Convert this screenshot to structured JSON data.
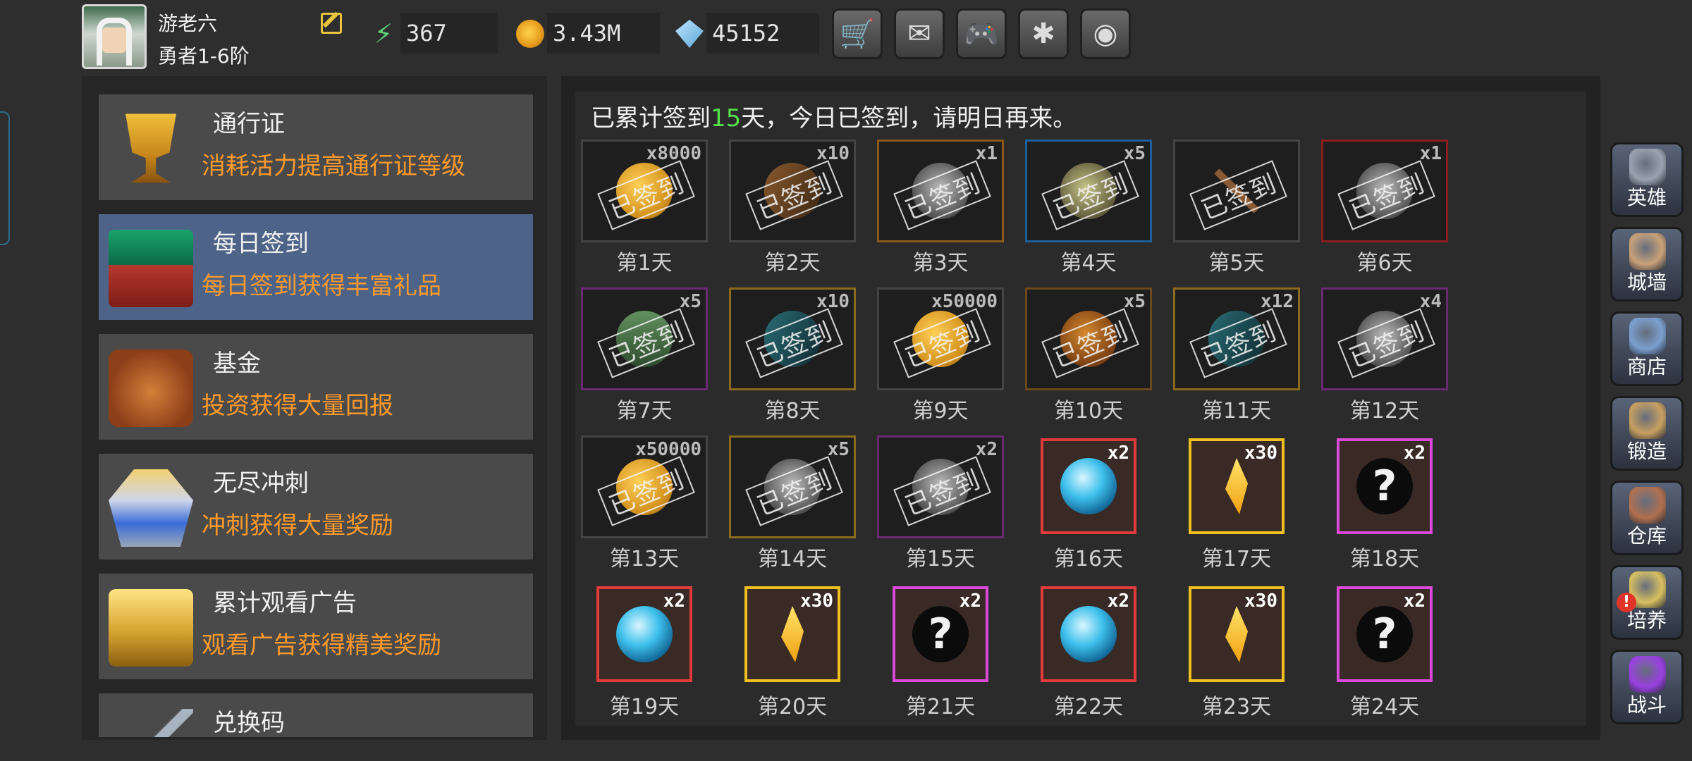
{
  "player": {
    "name": "游老六",
    "rank": "勇者1-6阶"
  },
  "resources": [
    {
      "name": "energy-icon",
      "value": "367"
    },
    {
      "name": "gold-icon",
      "value": "3.43M"
    },
    {
      "name": "gem-icon",
      "value": "45152"
    }
  ],
  "top_buttons": [
    {
      "name": "cart-icon",
      "glyph": "🛒"
    },
    {
      "name": "mail-icon",
      "glyph": "✉"
    },
    {
      "name": "gamepad-icon",
      "glyph": "🎮"
    },
    {
      "name": "gear-icon",
      "glyph": "✱"
    },
    {
      "name": "color-wheel-icon",
      "glyph": "◉"
    }
  ],
  "menu": [
    {
      "title": "通行证",
      "desc": "消耗活力提高通行证等级",
      "pic": "pic-cup",
      "icon": "goblet-icon",
      "active": false
    },
    {
      "title": "每日签到",
      "desc": "每日签到获得丰富礼品",
      "pic": "pic-chest-green",
      "icon": "chest-icon",
      "active": true
    },
    {
      "title": "基金",
      "desc": "投资获得大量回报",
      "pic": "pic-bag",
      "icon": "money-bag-icon",
      "active": false
    },
    {
      "title": "无尽冲刺",
      "desc": "冲刺获得大量奖励",
      "pic": "pic-statue",
      "icon": "statue-icon",
      "active": false
    },
    {
      "title": "累计观看广告",
      "desc": "观看广告获得精美奖励",
      "pic": "pic-chest-gold",
      "icon": "gold-chest-icon",
      "active": false
    },
    {
      "title": "兑换码",
      "desc": "",
      "pic": "pic-key",
      "icon": "key-icon",
      "active": false
    }
  ],
  "signin": {
    "prefix": "已累计签到",
    "days": "15",
    "suffix": "天，今日已签到，请明日再来。",
    "stamp": "已签到"
  },
  "rewards": [
    {
      "day": "第1天",
      "qty": "x8000",
      "item": "it-coin",
      "frame": "#444444",
      "signed": true
    },
    {
      "day": "第2天",
      "qty": "x10",
      "item": "it-book",
      "frame": "#444444",
      "signed": true
    },
    {
      "day": "第3天",
      "qty": "x1",
      "item": "it-skull",
      "frame": "#8a5a1c",
      "signed": true
    },
    {
      "day": "第4天",
      "qty": "x5",
      "item": "it-ore",
      "frame": "#1d5f9a",
      "signed": true
    },
    {
      "day": "第5天",
      "qty": "",
      "item": "it-bow",
      "frame": "#444444",
      "signed": true
    },
    {
      "day": "第6天",
      "qty": "x1",
      "item": "it-skull",
      "frame": "#8a1e1e",
      "signed": true
    },
    {
      "day": "第7天",
      "qty": "x5",
      "item": "it-gem-green",
      "frame": "#6a2a72",
      "signed": true
    },
    {
      "day": "第8天",
      "qty": "x10",
      "item": "it-tealbook",
      "frame": "#8a6a1c",
      "signed": true
    },
    {
      "day": "第9天",
      "qty": "x50000",
      "item": "it-coin",
      "frame": "#444444",
      "signed": true
    },
    {
      "day": "第10天",
      "qty": "x5",
      "item": "it-rock",
      "frame": "#6a4a1c",
      "signed": true
    },
    {
      "day": "第11天",
      "qty": "x12",
      "item": "it-tealbook",
      "frame": "#8a6a1c",
      "signed": true
    },
    {
      "day": "第12天",
      "qty": "x4",
      "item": "it-skull",
      "frame": "#6a2a72",
      "signed": true
    },
    {
      "day": "第13天",
      "qty": "x50000",
      "item": "it-coin",
      "frame": "#444444",
      "signed": true
    },
    {
      "day": "第14天",
      "qty": "x5",
      "item": "it-skull",
      "frame": "#8a6a1c",
      "signed": true
    },
    {
      "day": "第15天",
      "qty": "x2",
      "item": "it-skull",
      "frame": "#6a2a72",
      "signed": true
    },
    {
      "day": "第16天",
      "qty": "x2",
      "item": "it-orb",
      "frame": "#e03a3a",
      "signed": false
    },
    {
      "day": "第17天",
      "qty": "x30",
      "item": "it-crystal",
      "frame": "#f0c020",
      "signed": false
    },
    {
      "day": "第18天",
      "qty": "x2",
      "item": "it-question",
      "frame": "#d94ad9",
      "signed": false
    },
    {
      "day": "第19天",
      "qty": "x2",
      "item": "it-orb",
      "frame": "#e03a3a",
      "signed": false
    },
    {
      "day": "第20天",
      "qty": "x30",
      "item": "it-crystal",
      "frame": "#f0c020",
      "signed": false
    },
    {
      "day": "第21天",
      "qty": "x2",
      "item": "it-question",
      "frame": "#d94ad9",
      "signed": false
    },
    {
      "day": "第22天",
      "qty": "x2",
      "item": "it-orb",
      "frame": "#e03a3a",
      "signed": false
    },
    {
      "day": "第23天",
      "qty": "x30",
      "item": "it-crystal",
      "frame": "#f0c020",
      "signed": false
    },
    {
      "day": "第24天",
      "qty": "x2",
      "item": "it-question",
      "frame": "#d94ad9",
      "signed": false
    }
  ],
  "side_nav": [
    {
      "label": "英雄",
      "icon": "helmet-icon",
      "color": "#9aa4b0"
    },
    {
      "label": "城墙",
      "icon": "castle-wall-icon",
      "color": "#caa27a"
    },
    {
      "label": "商店",
      "icon": "shop-icon",
      "color": "#7aa0d0"
    },
    {
      "label": "锻造",
      "icon": "anvil-icon",
      "color": "#c8a060"
    },
    {
      "label": "仓库",
      "icon": "warehouse-icon",
      "color": "#b07050"
    },
    {
      "label": "培养",
      "icon": "trophy-icon",
      "color": "#d8c060",
      "alert": "!"
    },
    {
      "label": "战斗",
      "icon": "portal-icon",
      "color": "#9a40e0"
    }
  ],
  "question_glyph": "?"
}
